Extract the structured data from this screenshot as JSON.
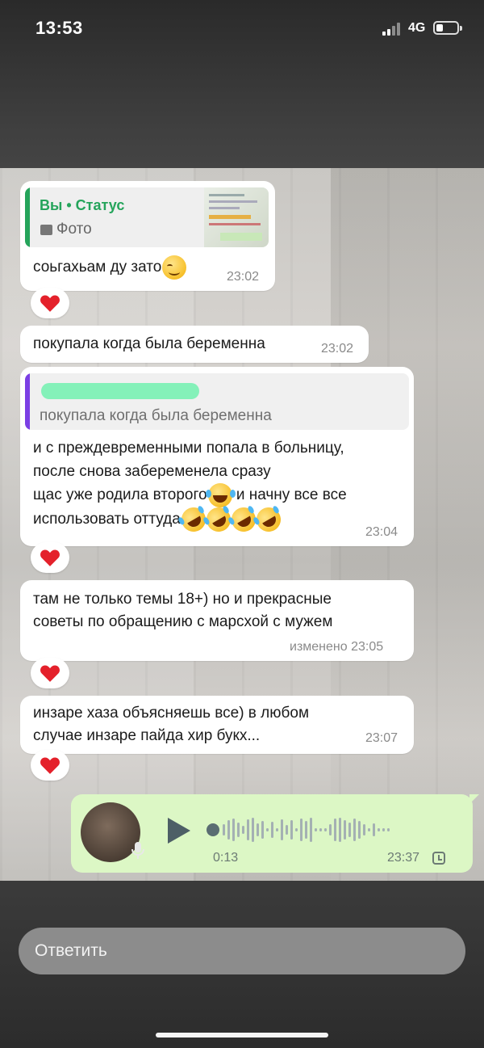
{
  "status_bar": {
    "time": "13:53",
    "network": "4G"
  },
  "messages": [
    {
      "quote": {
        "author": "Вы • Статус",
        "media_label": "Фото"
      },
      "text": "соьгахьам ду зато",
      "time": "23:02",
      "reaction": "heart"
    },
    {
      "text": "покупала когда была беременна",
      "time": "23:02"
    },
    {
      "quote": {
        "text": "покупала когда была беременна"
      },
      "lines": [
        "и с преждевременными попала в больницу,",
        "после снова забеременела сразу",
        "щас уже родила второго",
        "и начну все все",
        "использовать оттуда"
      ],
      "time": "23:04",
      "reaction": "heart"
    },
    {
      "lines": [
        "там не только темы 18+) но и прекрасные",
        "советы по обращению с марсхой с мужем"
      ],
      "time": "изменено 23:05",
      "reaction": "heart"
    },
    {
      "lines": [
        "инзаре хаза объясняешь все) в любом",
        "случае инзаре пайда хир букх..."
      ],
      "time": "23:07",
      "reaction": "heart"
    }
  ],
  "voice_message": {
    "duration": "0:13",
    "time": "23:37"
  },
  "reply_input": {
    "placeholder": "Ответить"
  },
  "colors": {
    "quote_green": "#25a45b",
    "quote_purple": "#7b3fe4",
    "outgoing_bubble": "#dcf7c5",
    "heart": "#e4212b"
  }
}
